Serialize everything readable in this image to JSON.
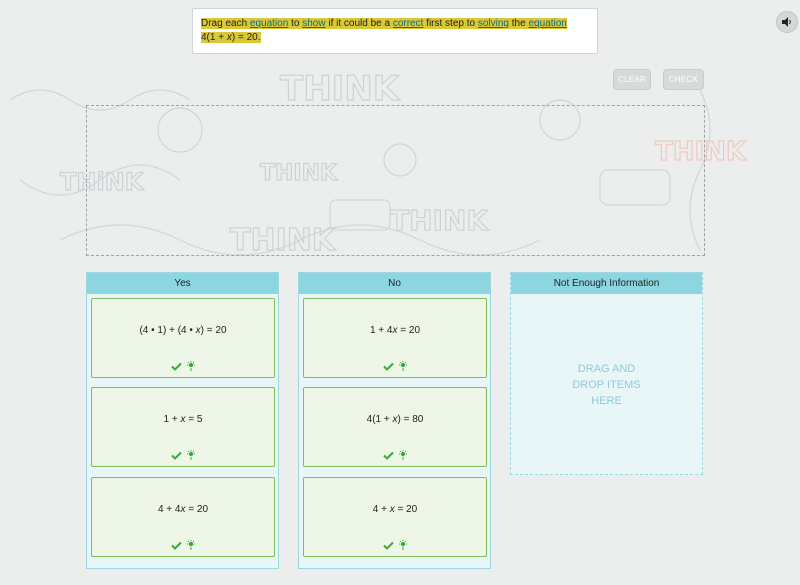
{
  "prompt": {
    "parts": [
      {
        "text": "Drag each ",
        "link": false
      },
      {
        "text": "equation",
        "link": true
      },
      {
        "text": " to ",
        "link": false
      },
      {
        "text": "show",
        "link": true
      },
      {
        "text": " if it could be a ",
        "link": false
      },
      {
        "text": "correct",
        "link": true
      },
      {
        "text": " first step to ",
        "link": false
      },
      {
        "text": "solving",
        "link": true
      },
      {
        "text": " the ",
        "link": false
      },
      {
        "text": "equation",
        "link": true
      }
    ],
    "equation_pre": "4(1 + ",
    "equation_var": "x",
    "equation_post": ") = 20."
  },
  "buttons": {
    "clear": "CLEAR",
    "check": "CHECK"
  },
  "background_words": [
    "THINK",
    "THiNK",
    "THINK",
    "THINK",
    "THINK",
    "THINK"
  ],
  "categories": {
    "yes": {
      "label": "Yes",
      "items": [
        {
          "pre": "(4 • 1) + (4 • ",
          "var": "x",
          "post": ") = 20"
        },
        {
          "pre": "1 + ",
          "var": "x",
          "post": " = 5"
        },
        {
          "pre": "4 + 4",
          "var": "x",
          "post": " = 20"
        }
      ]
    },
    "no": {
      "label": "No",
      "items": [
        {
          "pre": "1 + 4",
          "var": "x",
          "post": " = 20"
        },
        {
          "pre": "4(1 + ",
          "var": "x",
          "post": ") = 80"
        },
        {
          "pre": "4 + ",
          "var": "x",
          "post": " = 20"
        }
      ]
    },
    "not_enough": {
      "label": "Not Enough Information",
      "placeholder": "DRAG AND\nDROP ITEMS\nHERE"
    }
  },
  "colors": {
    "highlight": "#d9c937",
    "link": "#0b6b8a",
    "category_header": "#8bd6e0",
    "correct_green": "#3aa93a",
    "tile_border": "#7fbf5a"
  }
}
